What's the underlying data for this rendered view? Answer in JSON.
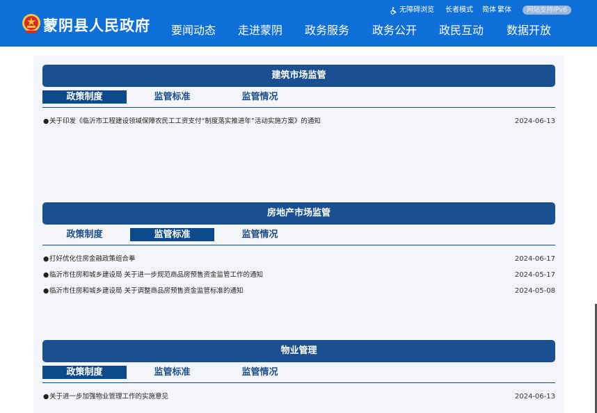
{
  "header": {
    "site_title": "蒙阴县人民政府",
    "top_links": {
      "accessibility": "无障碍浏览",
      "elder_mode": "长者模式",
      "simplified": "简体",
      "traditional": "繁体",
      "ipv6": "网站支持IPv6"
    },
    "nav": [
      "要闻动态",
      "走进蒙阴",
      "政务服务",
      "政务公开",
      "政民互动",
      "数据开放"
    ],
    "colors": {
      "header_bg": "#0f6fd9",
      "section_title_bg": "#1a4f92",
      "active_tab_bg": "#0d4a8c"
    }
  },
  "sections": [
    {
      "title": "建筑市场监管",
      "tabs": [
        "政策制度",
        "监管标准",
        "监管情况"
      ],
      "active_tab": 0,
      "items": [
        {
          "title": "关于印发《临沂市工程建设领域保障农民工工资支付“制度落实推进年”活动实施方案》的通知",
          "date": "2024-06-13"
        }
      ]
    },
    {
      "title": "房地产市场监管",
      "tabs": [
        "政策制度",
        "监管标准",
        "监管情况"
      ],
      "active_tab": 1,
      "items": [
        {
          "title": "打好优化住房金融政策组合拳",
          "date": "2024-06-17"
        },
        {
          "title": "临沂市住房和城乡建设局 关于进一步规范商品房预售资金监管工作的通知",
          "date": "2024-05-17"
        },
        {
          "title": "临沂市住房和城乡建设局 关于调整商品房预售资金监管标准的通知",
          "date": "2024-05-08"
        }
      ]
    },
    {
      "title": "物业管理",
      "tabs": [
        "政策制度",
        "监管标准",
        "监管情况"
      ],
      "active_tab": 0,
      "items": [
        {
          "title": "关于进一步加强物业管理工作的实施意见",
          "date": "2024-06-13"
        }
      ]
    }
  ],
  "icons": {
    "emblem": "national-emblem-icon",
    "accessibility": "wheelchair-icon",
    "bullet": "●"
  }
}
